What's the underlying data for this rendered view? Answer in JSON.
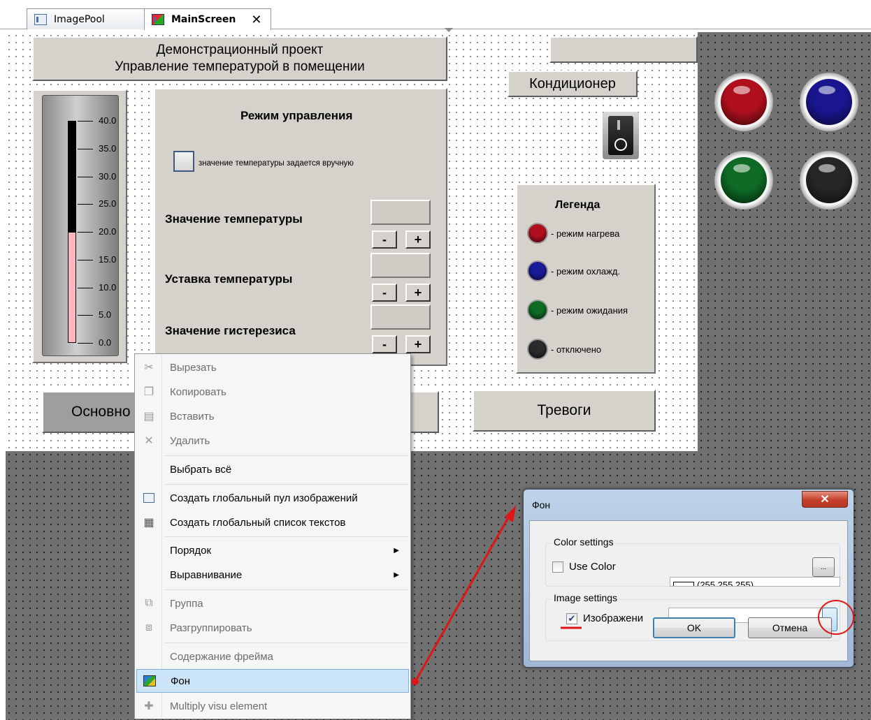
{
  "tabs": [
    {
      "label": "ImagePool",
      "active": false
    },
    {
      "label": "MainScreen",
      "active": true
    }
  ],
  "screen": {
    "title_line1": "Демонстрационный проект",
    "title_line2": "Управление температурой в помещении",
    "conditioner_label": "Кондиционер",
    "thermometer": {
      "scale": [
        "40.0",
        "35.0",
        "30.0",
        "25.0",
        "20.0",
        "15.0",
        "10.0",
        "5.0",
        "0.0"
      ],
      "value": 20.0,
      "min": 0,
      "max": 40
    },
    "control": {
      "title": "Режим управления",
      "manual_checkbox_label": "значение температуры задается вручную",
      "temp_value_label": "Значение температуры",
      "setpoint_label": "Уставка температуры",
      "hysteresis_label": "Значение гистерезиса",
      "minus": "-",
      "plus": "+"
    },
    "legend": {
      "title": "Легенда",
      "items": [
        {
          "label": "- режим нагрева",
          "color": "#b0101e"
        },
        {
          "label": "- режим охлажд.",
          "color": "#1a1a9a"
        },
        {
          "label": "- режим ожидания",
          "color": "#0d6b24"
        },
        {
          "label": "- отключено",
          "color": "#2a2a2a"
        }
      ]
    },
    "leds": [
      {
        "name": "red",
        "color": "#b0101e"
      },
      {
        "name": "blue",
        "color": "#1a1690"
      },
      {
        "name": "green",
        "color": "#0e6a25"
      },
      {
        "name": "black",
        "color": "#262626"
      }
    ],
    "nav": {
      "main_label": "Основно",
      "alarms_label": "Тревоги"
    }
  },
  "context_menu": {
    "items": [
      {
        "label": "Вырезать",
        "icon": "scissors-icon",
        "disabled": true
      },
      {
        "label": "Копировать",
        "icon": "copy-icon",
        "disabled": true
      },
      {
        "label": "Вставить",
        "icon": "paste-icon",
        "disabled": true
      },
      {
        "label": "Удалить",
        "icon": "delete-icon",
        "disabled": true
      },
      {
        "label": "Выбрать всё",
        "icon": "",
        "disabled": false
      },
      {
        "label": "Создать глобальный пул изображений",
        "icon": "image-pool-icon",
        "disabled": false
      },
      {
        "label": "Создать глобальный список текстов",
        "icon": "text-list-icon",
        "disabled": false
      },
      {
        "label": "Порядок",
        "icon": "",
        "disabled": false,
        "submenu": true
      },
      {
        "label": "Выравнивание",
        "icon": "",
        "disabled": false,
        "submenu": true
      },
      {
        "label": "Группа",
        "icon": "group-icon",
        "disabled": true
      },
      {
        "label": "Разгруппировать",
        "icon": "ungroup-icon",
        "disabled": true
      },
      {
        "label": "Содержание фрейма",
        "icon": "",
        "disabled": true
      },
      {
        "label": "Фон",
        "icon": "background-icon",
        "disabled": false,
        "highlighted": true
      },
      {
        "label": "Multiply visu element",
        "icon": "multiply-icon",
        "disabled": true
      }
    ]
  },
  "dialog": {
    "title": "Фон",
    "close": "x",
    "color_group": "Color settings",
    "use_color_label": "Use Color",
    "use_color_checked": false,
    "color_value": "(255,255,255)",
    "browse": "...",
    "image_group": "Image settings",
    "image_label": "Изображени",
    "image_checked": true,
    "ok": "OK",
    "cancel": "Отмена"
  },
  "colors": {
    "panel": "#d5d2cb",
    "highlight": "#cce4f7",
    "annotation": "#e01515"
  }
}
